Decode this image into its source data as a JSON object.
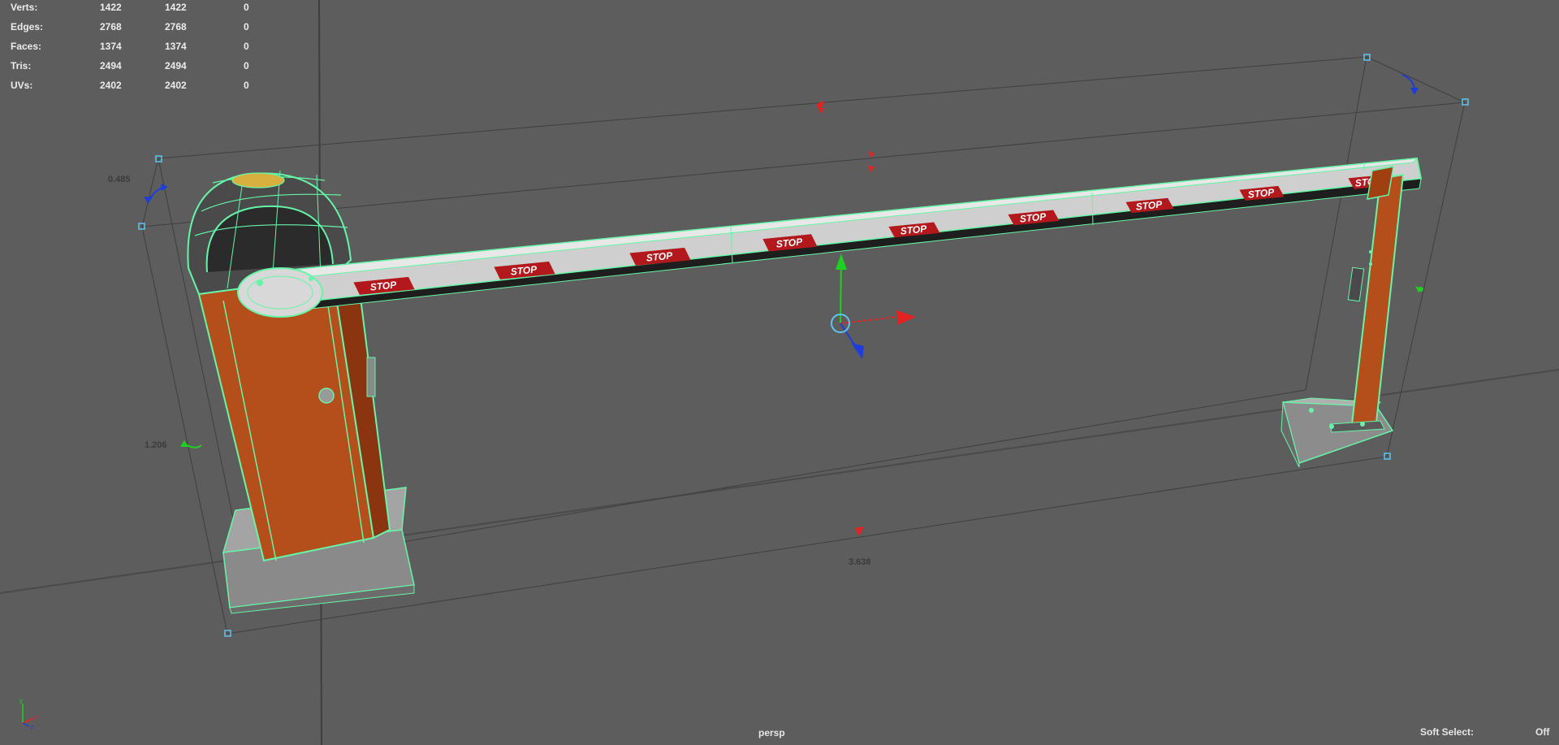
{
  "viewport": {
    "camera": "persp",
    "soft_select": {
      "label": "Soft Select:",
      "value": "Off"
    }
  },
  "stats": [
    {
      "label": "Verts:",
      "v1": "1422",
      "v2": "1422",
      "v3": "0"
    },
    {
      "label": "Edges:",
      "v1": "2768",
      "v2": "2768",
      "v3": "0"
    },
    {
      "label": "Faces:",
      "v1": "1374",
      "v2": "1374",
      "v3": "0"
    },
    {
      "label": "Tris:",
      "v1": "2494",
      "v2": "2494",
      "v3": "0"
    },
    {
      "label": "UVs:",
      "v1": "2402",
      "v2": "2402",
      "v3": "0"
    }
  ],
  "dimensions": {
    "height": "0.485",
    "depth": "1.206",
    "width": "3.638"
  },
  "barrier_sign": "STOP",
  "axis_labels": {
    "x": "x",
    "y": "y",
    "z": "z"
  },
  "colors": {
    "background": "#5d5d5d",
    "wireframe": "#66f5a8",
    "housing": "#b44e1a",
    "bbox": "#4aa0c8",
    "gizmo_x": "#e32222",
    "gizmo_y": "#20d020",
    "gizmo_z": "#1d3ce0"
  }
}
